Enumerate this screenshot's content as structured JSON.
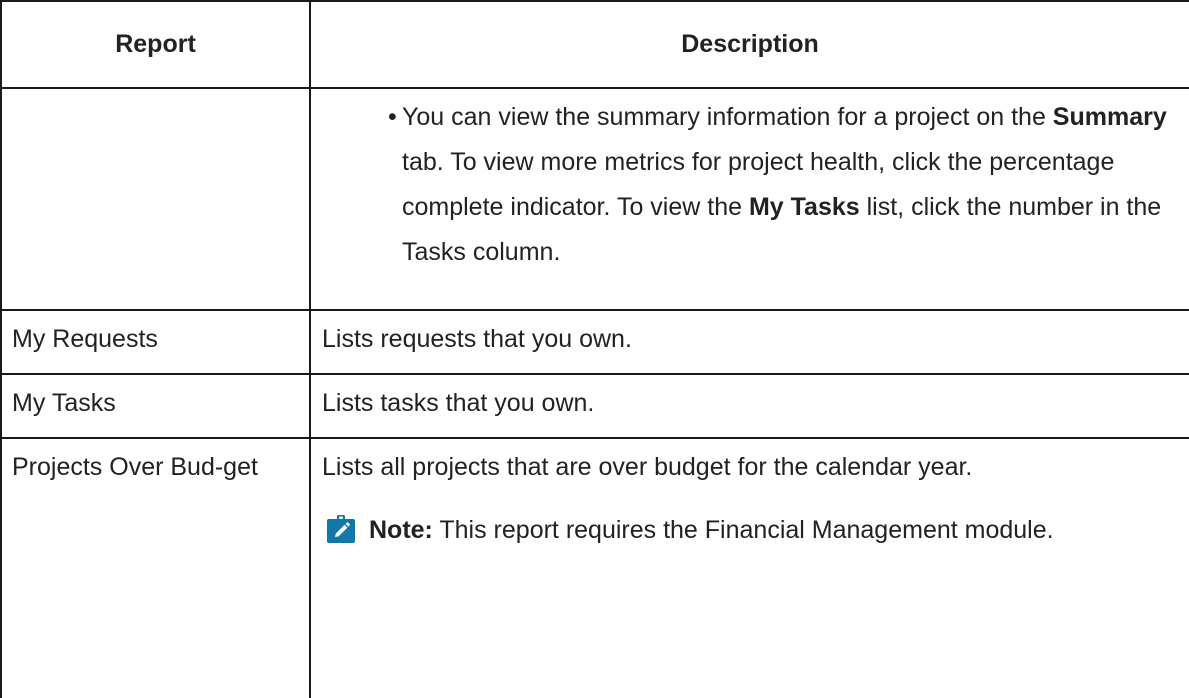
{
  "table": {
    "headers": {
      "report": "Report",
      "description": "Description"
    },
    "continuation": {
      "bullet": "•",
      "parts": {
        "p1": "You can view the summary information for a project on the ",
        "b1": "Summary",
        "p2": " tab. To view more metrics for project health, click the percentage complete indicator. To view the ",
        "b2": "My Tasks",
        "p3": " list, click the number in the Tasks column."
      }
    },
    "rows": [
      {
        "report": "My Requests",
        "description": "Lists requests that you own."
      },
      {
        "report": "My Tasks",
        "description": "Lists tasks that you own."
      },
      {
        "report": "Projects Over Bud-get",
        "description": "Lists all projects that are over budget for the calendar year.",
        "note": {
          "label": "Note:",
          "text": " This report requires the Financial Management module.",
          "icon": "note-pencil-icon",
          "icon_color": "#1377a8"
        }
      }
    ]
  }
}
